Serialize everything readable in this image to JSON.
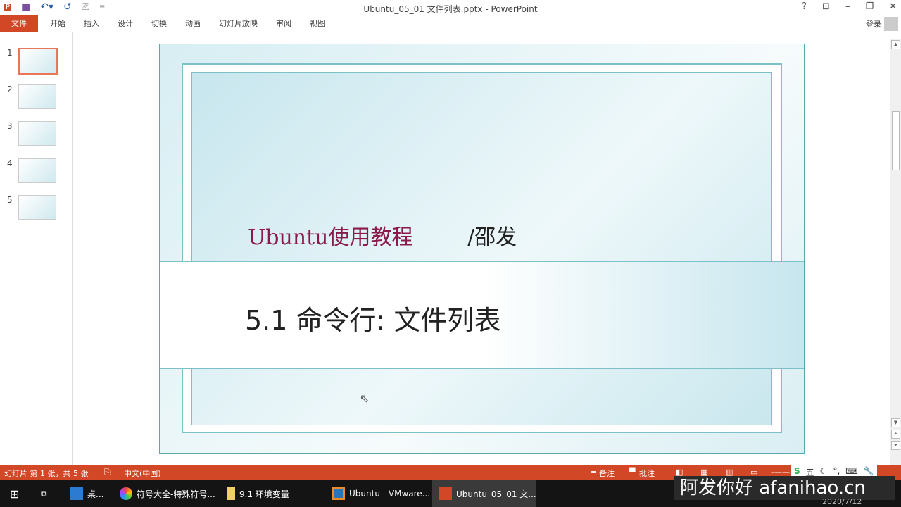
{
  "window": {
    "title": "Ubuntu_05_01 文件列表.pptx - PowerPoint",
    "help": "?",
    "login": "登录"
  },
  "ribbon": {
    "tabs": [
      "文件",
      "开始",
      "插入",
      "设计",
      "切换",
      "动画",
      "幻灯片放映",
      "审阅",
      "视图"
    ]
  },
  "thumbnails": [
    "1",
    "2",
    "3",
    "4",
    "5"
  ],
  "slide": {
    "subtitle": "Ubuntu使用教程",
    "author": "/邵发",
    "heading": "5.1 命令行: 文件列表"
  },
  "status": {
    "slide_info": "幻灯片 第 1 张，共 5 张",
    "language": "中文(中国)",
    "notes": "备注",
    "comments": "批注"
  },
  "taskbar": {
    "items": [
      "桌...",
      "符号大全-特殊符号...",
      "9.1 环境变量",
      "Ubuntu - VMware...",
      "Ubuntu_05_01 文..."
    ],
    "ime": "五",
    "date": "2020/7/12"
  },
  "watermark": "阿发你好 afanihao.cn"
}
